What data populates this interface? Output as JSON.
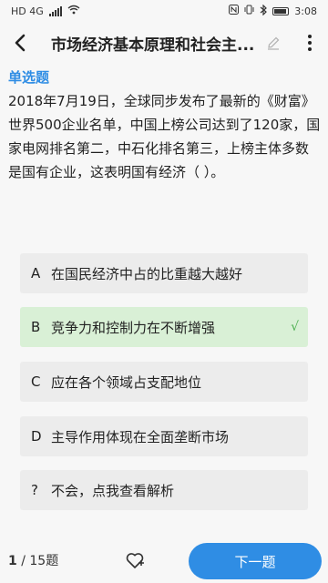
{
  "status": {
    "carrier": "HD 4G",
    "time": "3:08"
  },
  "header": {
    "title": "市场经济基本原理和社会主..."
  },
  "question": {
    "type_label": "单选题",
    "text": "2018年7月19日，全球同步发布了最新的《财富》世界500企业名单，中国上榜公司达到了120家，国家电网排名第二，中石化排名第三，上榜主体多数是国有企业，这表明国有经济（ ）。",
    "options": [
      {
        "key": "A",
        "text": "在国民经济中占的比重越大越好",
        "correct": false
      },
      {
        "key": "B",
        "text": "竞争力和控制力在不断增强",
        "correct": true,
        "mark": "√"
      },
      {
        "key": "C",
        "text": "应在各个领域占支配地位",
        "correct": false
      },
      {
        "key": "D",
        "text": "主导作用体现在全面垄断市场",
        "correct": false
      },
      {
        "key": "?",
        "text": "不会，点我查看解析",
        "correct": false
      }
    ]
  },
  "footer": {
    "current": "1",
    "separator": "/",
    "total": "15题",
    "next_label": "下一题"
  },
  "colors": {
    "accent": "#2f8de4",
    "correct_bg": "#d9f0d6",
    "option_bg": "#ececec"
  }
}
